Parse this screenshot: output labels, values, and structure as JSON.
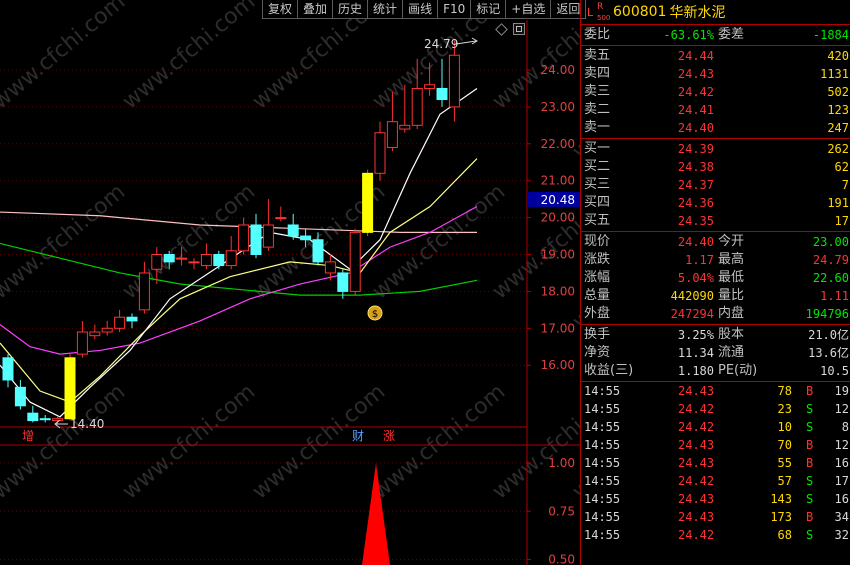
{
  "toolbar": {
    "buttons": [
      "复权",
      "叠加",
      "历史",
      "统计",
      "画线",
      "F10",
      "标记",
      "+自选",
      "返回"
    ]
  },
  "chart": {
    "price_axis_labels": [
      "24.00",
      "23.00",
      "22.00",
      "21.00",
      "20.00",
      "19.00",
      "18.00",
      "17.00",
      "16.00"
    ],
    "current_price_tag": "20.48",
    "high_annotation": "24.79",
    "low_annotation": "14.40",
    "markers": {
      "zeng": "增",
      "cai": "财",
      "zhang": "涨"
    },
    "sub_axis_labels": [
      "1.00",
      "0.75",
      "0.50"
    ],
    "watermark": "www.cfchi.com",
    "colors": {
      "up": "#ff3232",
      "down": "#54ffff",
      "highlight": "#ffff00",
      "ma_white": "#ffffff",
      "ma_yellow": "#ffff80",
      "ma_magenta": "#ff40ff",
      "ma_green": "#00d000",
      "ma_pink": "#ffc0c0"
    }
  },
  "stock": {
    "code": "600801",
    "name": "华新水泥",
    "prefix_l": "L",
    "prefix_r": "R",
    "prefix_num": "500"
  },
  "order_ratio": {
    "label_ratio": "委比",
    "ratio": "-63.61%",
    "label_diff": "委差",
    "diff": "-1884"
  },
  "asks": [
    {
      "label": "卖五",
      "price": "24.44",
      "vol": "420"
    },
    {
      "label": "卖四",
      "price": "24.43",
      "vol": "1131"
    },
    {
      "label": "卖三",
      "price": "24.42",
      "vol": "502"
    },
    {
      "label": "卖二",
      "price": "24.41",
      "vol": "123"
    },
    {
      "label": "卖一",
      "price": "24.40",
      "vol": "247"
    }
  ],
  "bids": [
    {
      "label": "买一",
      "price": "24.39",
      "vol": "262"
    },
    {
      "label": "买二",
      "price": "24.38",
      "vol": "62"
    },
    {
      "label": "买三",
      "price": "24.37",
      "vol": "7"
    },
    {
      "label": "买四",
      "price": "24.36",
      "vol": "191"
    },
    {
      "label": "买五",
      "price": "24.35",
      "vol": "17"
    }
  ],
  "quote": [
    {
      "l1": "现价",
      "v1": "24.40",
      "c1": "red",
      "l2": "今开",
      "v2": "23.00",
      "c2": "green"
    },
    {
      "l1": "涨跌",
      "v1": "1.17",
      "c1": "red",
      "l2": "最高",
      "v2": "24.79",
      "c2": "red"
    },
    {
      "l1": "涨幅",
      "v1": "5.04%",
      "c1": "red",
      "l2": "最低",
      "v2": "22.60",
      "c2": "green"
    },
    {
      "l1": "总量",
      "v1": "442090",
      "c1": "yellow",
      "l2": "量比",
      "v2": "1.11",
      "c2": "red"
    },
    {
      "l1": "外盘",
      "v1": "247294",
      "c1": "red",
      "l2": "内盘",
      "v2": "194796",
      "c2": "green"
    }
  ],
  "fundamentals": [
    {
      "l1": "换手",
      "v1": "3.25%",
      "l2": "股本",
      "v2": "21.0亿"
    },
    {
      "l1": "净资",
      "v1": "11.34",
      "l2": "流通",
      "v2": "13.6亿"
    },
    {
      "l1": "收益(三)",
      "v1": "1.180",
      "l2": "PE(动)",
      "v2": "10.5"
    }
  ],
  "ticks": [
    {
      "time": "14:55",
      "price": "24.43",
      "vol": "78",
      "bs": "B",
      "n": "19"
    },
    {
      "time": "14:55",
      "price": "24.42",
      "vol": "23",
      "bs": "S",
      "n": "12"
    },
    {
      "time": "14:55",
      "price": "24.42",
      "vol": "10",
      "bs": "S",
      "n": "8"
    },
    {
      "time": "14:55",
      "price": "24.43",
      "vol": "70",
      "bs": "B",
      "n": "12"
    },
    {
      "time": "14:55",
      "price": "24.43",
      "vol": "55",
      "bs": "B",
      "n": "16"
    },
    {
      "time": "14:55",
      "price": "24.42",
      "vol": "57",
      "bs": "S",
      "n": "17"
    },
    {
      "time": "14:55",
      "price": "24.43",
      "vol": "143",
      "bs": "S",
      "n": "16"
    },
    {
      "time": "14:55",
      "price": "24.43",
      "vol": "173",
      "bs": "B",
      "n": "34"
    },
    {
      "time": "14:55",
      "price": "24.42",
      "vol": "68",
      "bs": "S",
      "n": "32"
    }
  ]
}
